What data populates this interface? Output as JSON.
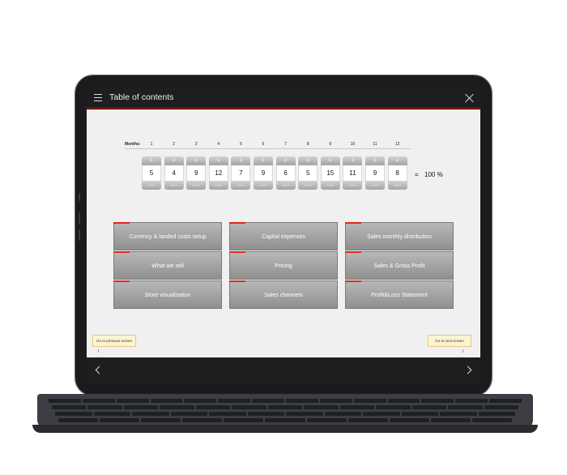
{
  "header": {
    "title": "Table of contents"
  },
  "months": {
    "label": "Months:",
    "numbers": [
      "1",
      "2",
      "3",
      "4",
      "5",
      "6",
      "7",
      "8",
      "9",
      "10",
      "11",
      "12"
    ],
    "values": [
      "5",
      "4",
      "9",
      "12",
      "7",
      "9",
      "6",
      "5",
      "15",
      "11",
      "9",
      "8"
    ],
    "plus_glyph": "+",
    "minus_glyph": "—",
    "equals": "=",
    "total": "100 %"
  },
  "toc": {
    "columns": [
      [
        "Currency & landed costs setup",
        "What we sell",
        "Store visualisation"
      ],
      [
        "Capital expenses",
        "Pricing",
        "Sales channels"
      ],
      [
        "Sales monthly distribution",
        "Sales & Gross Profit",
        "Profit&Loss Statement"
      ]
    ]
  },
  "nav": {
    "prev": "Go to previous screen",
    "next": "Go to next screen"
  },
  "colors": {
    "accent": "#e0261b",
    "header_bg": "#1e1e20",
    "content_bg": "#f0f0f0"
  },
  "icons": {
    "menu": "hamburger-icon",
    "close": "close-icon",
    "prev": "chevron-left-icon",
    "next": "chevron-right-icon"
  }
}
